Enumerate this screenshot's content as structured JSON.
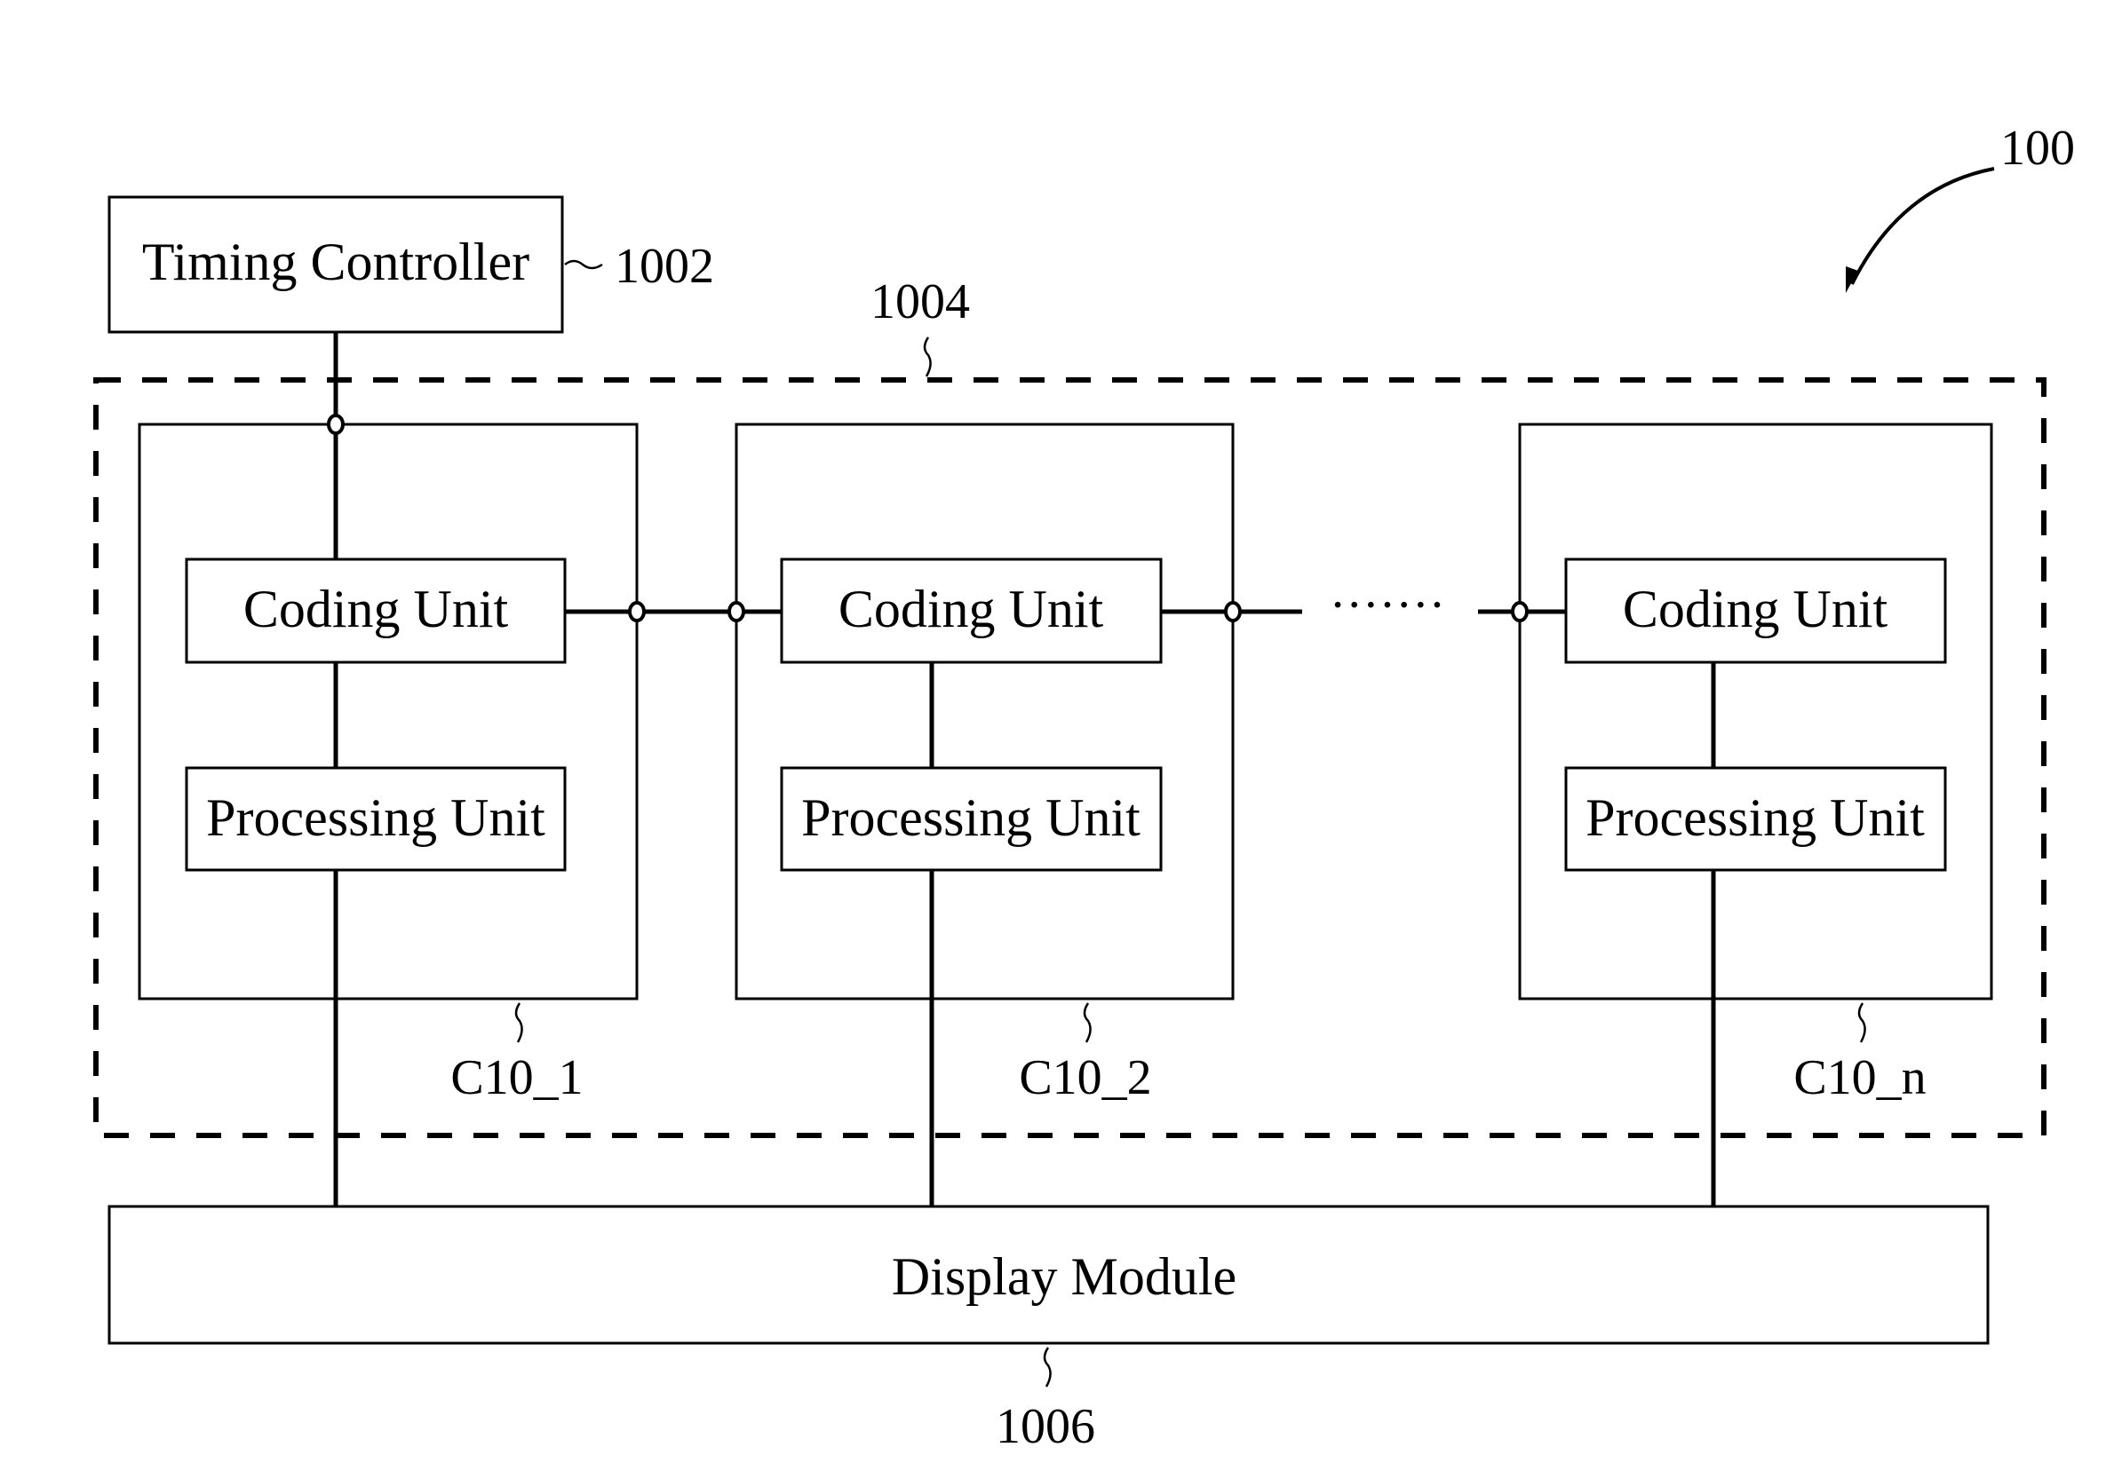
{
  "figure_ref": "100",
  "timing_controller": {
    "label": "Timing Controller",
    "ref": "1002"
  },
  "coding_module_group": {
    "ref": "1004"
  },
  "blocks": [
    {
      "ref": "C10_1",
      "coding_label": "Coding Unit",
      "processing_label": "Processing Unit"
    },
    {
      "ref": "C10_2",
      "coding_label": "Coding Unit",
      "processing_label": "Processing Unit"
    },
    {
      "ref": "C10_n",
      "coding_label": "Coding Unit",
      "processing_label": "Processing Unit"
    }
  ],
  "ellipsis": "·······",
  "display_module": {
    "label": "Display Module",
    "ref": "1006"
  }
}
